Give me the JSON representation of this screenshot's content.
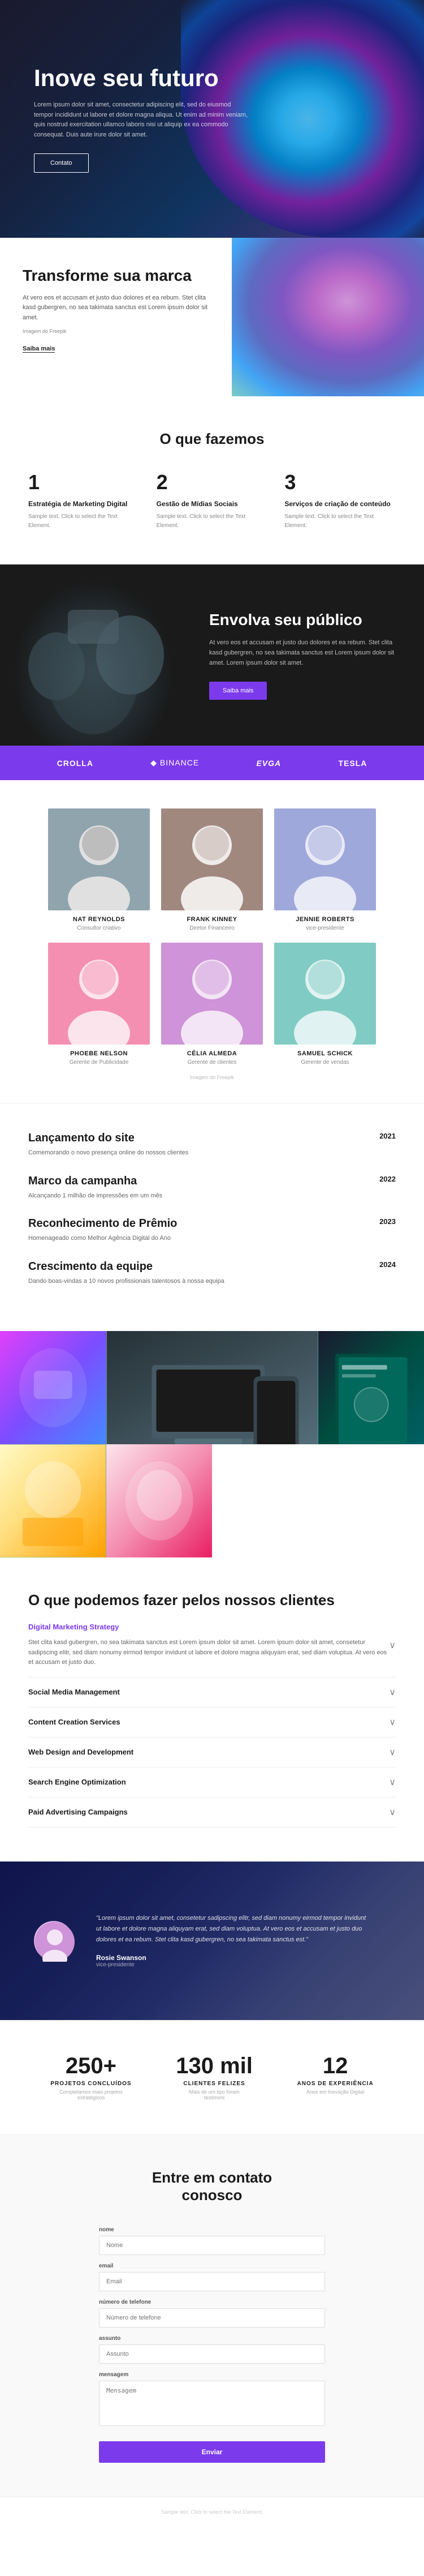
{
  "hero": {
    "title": "Inove seu futuro",
    "description": "Lorem ipsum dolor sit amet, consectetur adipiscing elit, sed do eiusmod tempor incididunt ut labore et dolore magna aliqua. Ut enim ad minim veniam, quis nostrud exercitation ullamco laboris nisi ut aliquip ex ea commodo consequat. Duis aute irure dolor sit amet.",
    "cta_label": "Contato"
  },
  "transform": {
    "title": "Transforme sua marca",
    "description": "At vero eos et accusam et justo duo dolores et ea rebum. Stet clita kasd gubergren, no sea takimata sanctus est Lorem ipsum dolor sit amet.",
    "caption": "Imagem do Freepik",
    "link_label": "Saiba mais"
  },
  "what_we_do": {
    "title": "O que fazemos",
    "services": [
      {
        "number": "1",
        "title": "Estratégia de Marketing Digital",
        "description": "Sample text. Click to select the Text Element."
      },
      {
        "number": "2",
        "title": "Gestão de Mídias Sociais",
        "description": "Sample text. Click to select the Text Element."
      },
      {
        "number": "3",
        "title": "Serviços de criação de conteúdo",
        "description": "Sample text. Click to select the Text Element."
      }
    ]
  },
  "engage": {
    "title": "Envolva seu público",
    "description": "At vero eos et accusam et justo duo dolores et ea rebum. Stet clita kasd gubergren, no sea takimata sanctus est Lorem ipsum dolor sit amet. Lorem ipsum dolor sit amet.",
    "cta_label": "Saiba mais"
  },
  "brands": [
    {
      "name": "CROLLA",
      "style": "normal"
    },
    {
      "name": "◆ BINANCE",
      "style": "thin"
    },
    {
      "name": "EVGA",
      "style": "italic"
    },
    {
      "name": "TESLA",
      "style": "normal"
    }
  ],
  "team": {
    "members": [
      {
        "name": "NAT REYNOLDS",
        "role": "Consultor criativo",
        "photo": "male"
      },
      {
        "name": "FRANK KINNEY",
        "role": "Diretor Financeiro",
        "photo": "male2"
      },
      {
        "name": "JENNIE ROBERTS",
        "role": "vice-presidente",
        "photo": "female"
      },
      {
        "name": "PHOEBE NELSON",
        "role": "Gerente de Publicidade",
        "photo": "female2"
      },
      {
        "name": "CÉLIA ALMEDA",
        "role": "Gerente de clientes",
        "photo": "female3"
      },
      {
        "name": "SAMUEL SCHICK",
        "role": "Gerente de vendas",
        "photo": "male3"
      }
    ],
    "caption": "Imagem do Freepik"
  },
  "timeline": [
    {
      "year": "2021",
      "title": "Lançamento do site",
      "description": "Comemorando o novo presença online do nossos clientes"
    },
    {
      "year": "2022",
      "title": "Marco da campanha",
      "description": "Alcançando 1 milhão de impressões em um mês"
    },
    {
      "year": "2023",
      "title": "Reconhecimento de Prêmio",
      "description": "Homenageado como Melhor Agência Digital do Ano"
    },
    {
      "year": "2024",
      "title": "Crescimento da equipe",
      "description": "Dando boas-vindas a 10 novos profissionais talentosos à nossa equipa"
    }
  ],
  "services_clients": {
    "title": "O que podemos fazer pelos nossos clientes",
    "active_item": {
      "title": "Digital Marketing Strategy",
      "description": "Stet clita kasd gubergren, no sea takimata sanctus est Lorem ipsum dolor sit amet. Lorem ipsum dolor sit amet, consetetur sadipscing elitr, sed diam nonumy eirmod tempor invidunt ut labore et dolore magna aliquyam erat, sed diam voluptua. At vero eos et accusam et justo duo."
    },
    "items": [
      {
        "title": "Digital Marketing Strategy",
        "active": true
      },
      {
        "title": "Social Media Management",
        "active": false
      },
      {
        "title": "Content Creation Services",
        "active": false
      },
      {
        "title": "Web Design and Development",
        "active": false
      },
      {
        "title": "Search Engine Optimization",
        "active": false
      },
      {
        "title": "Paid Advertising Campaigns",
        "active": false
      }
    ]
  },
  "testimonial": {
    "quote": "\"Lorem ipsum dolor sit amet, consetetur sadipscing elitr, sed diam nonumy eirmod tempor invidunt ut labore et dolore magna aliquyam erat, sed diam voluptua. At vero eos et accusam et justo duo dolores et ea rebum. Stet clita kasd gubergren, no sea takimata sanctus est.\"",
    "name": "Rosie Swanson",
    "role": "vice-presidente"
  },
  "stats": [
    {
      "number": "250+",
      "label": "PROJETOS CONCLUÍDOS",
      "description": "Completamos mais projetos estratégicos"
    },
    {
      "number": "130 mil",
      "label": "CLIENTES FELIZES",
      "description": "Mais de um tipo foram testimoni"
    },
    {
      "number": "12",
      "label": "ANOS DE EXPERIÊNCIA",
      "description": "Anos em Inovação Digital"
    }
  ],
  "contact": {
    "title": "Entre em contato\nconosco",
    "fields": [
      {
        "label": "nome",
        "placeholder": "Nome",
        "type": "text"
      },
      {
        "label": "email",
        "placeholder": "Email",
        "type": "email"
      },
      {
        "label": "número de telefone",
        "placeholder": "Número de telefone",
        "type": "tel"
      },
      {
        "label": "assunto",
        "placeholder": "Assunto",
        "type": "text"
      },
      {
        "label": "mensagem",
        "placeholder": "Mensagem",
        "type": "textarea"
      }
    ],
    "submit_label": "Enviar"
  },
  "footer": {
    "note": "Sample text. Click to select the Text Element."
  }
}
